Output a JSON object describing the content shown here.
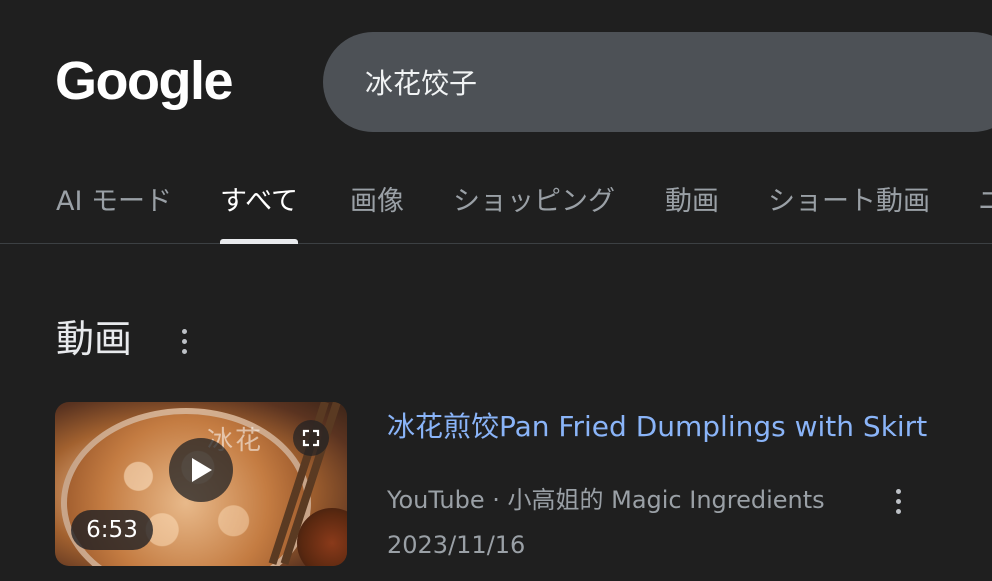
{
  "header": {
    "logo_text": "Google",
    "search": {
      "value": "冰花饺子"
    }
  },
  "tabs": [
    {
      "label": "AI モード",
      "active": false
    },
    {
      "label": "すべて",
      "active": true
    },
    {
      "label": "画像",
      "active": false
    },
    {
      "label": "ショッピング",
      "active": false
    },
    {
      "label": "動画",
      "active": false
    },
    {
      "label": "ショート動画",
      "active": false
    },
    {
      "label": "ニ",
      "active": false
    }
  ],
  "section": {
    "title": "動画",
    "menu_icon": "more-vert-icon"
  },
  "video": {
    "title": "冰花煎饺Pan Fried Dumplings with Skirt",
    "thumbnail_overlay_text": "冰花",
    "duration": "6:53",
    "source": "YouTube · 小高姐的 Magic Ingredients",
    "date": "2023/11/16",
    "play_icon": "play-icon",
    "expand_icon": "expand-icon",
    "menu_icon": "more-vert-icon"
  },
  "colors": {
    "background": "#1f1f1f",
    "search_bg": "#4d5156",
    "link": "#8ab4f8",
    "muted_text": "#9aa0a6"
  }
}
